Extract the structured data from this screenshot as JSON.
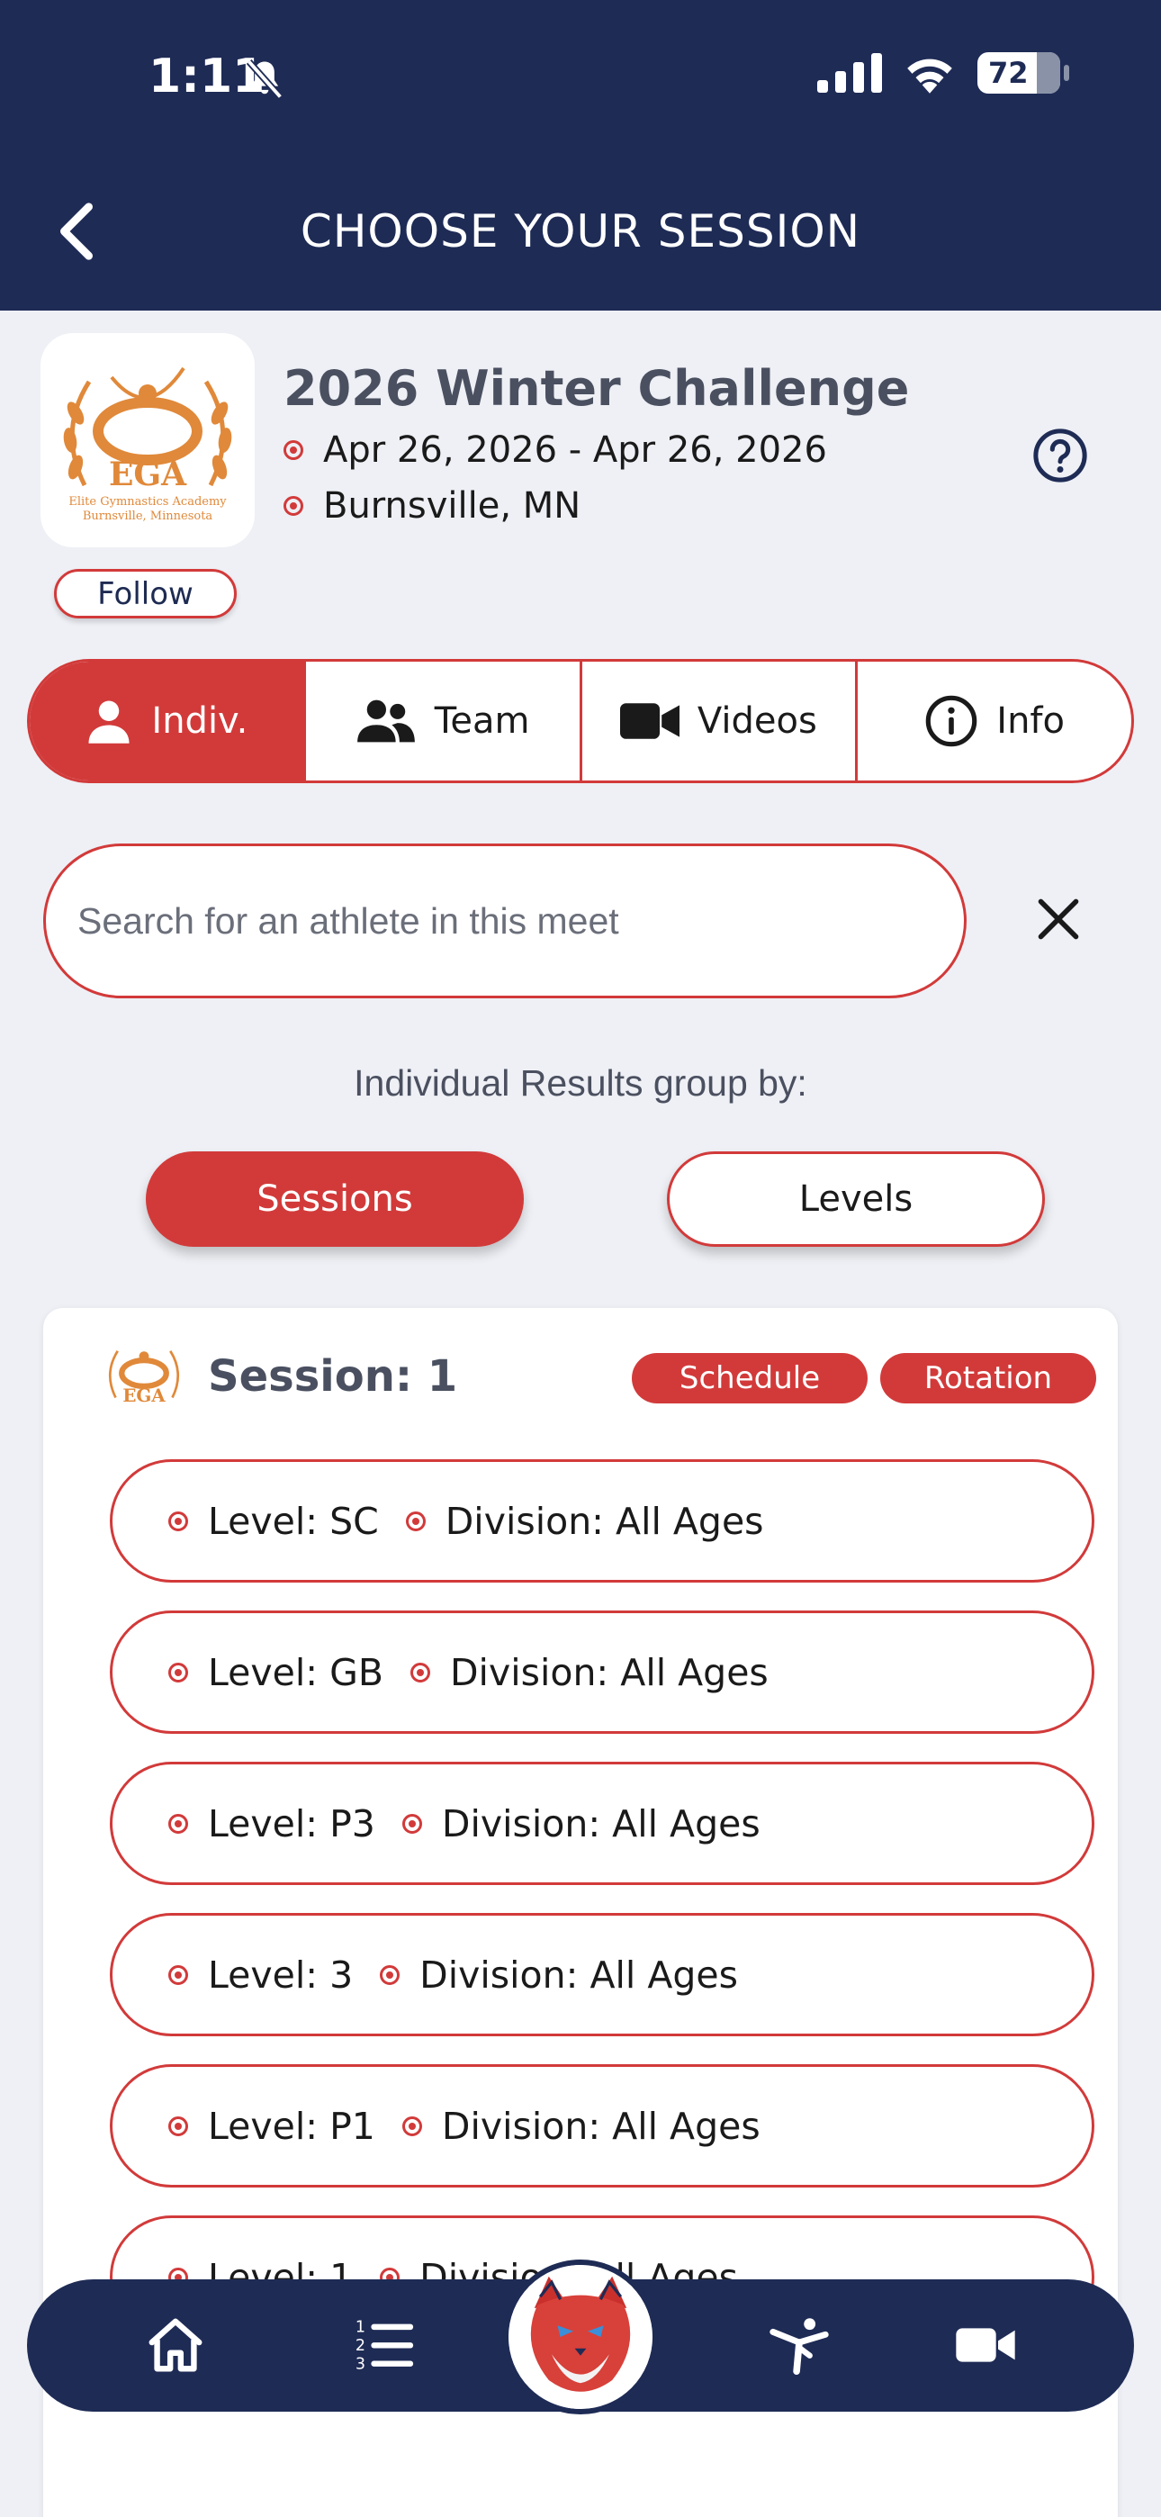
{
  "status_bar": {
    "time": "1:11",
    "battery": "72"
  },
  "header": {
    "title": "CHOOSE YOUR SESSION"
  },
  "meet": {
    "logo_text": "EGA",
    "logo_subtitle_1": "Elite Gymnastics Academy",
    "logo_subtitle_2": "Burnsville, Minnesota",
    "title": "2026 Winter Challenge",
    "dates": "Apr 26, 2026 - Apr 26, 2026",
    "location": "Burnsville, MN",
    "follow_label": "Follow"
  },
  "tabs": [
    {
      "label": "Indiv.",
      "icon": "person-icon",
      "active": true
    },
    {
      "label": "Team",
      "icon": "people-icon",
      "active": false
    },
    {
      "label": "Videos",
      "icon": "video-icon",
      "active": false
    },
    {
      "label": "Info",
      "icon": "info-icon",
      "active": false
    }
  ],
  "search": {
    "placeholder": "Search for an athlete in this meet",
    "value": ""
  },
  "grouping": {
    "label": "Individual Results group by:",
    "sessions_label": "Sessions",
    "levels_label": "Levels",
    "selected": "Sessions"
  },
  "session": {
    "title": "Session: 1",
    "schedule_label": "Schedule",
    "rotation_label": "Rotation",
    "levels": [
      {
        "level": "Level: SC",
        "division": "Division: All Ages"
      },
      {
        "level": "Level: GB",
        "division": "Division: All Ages"
      },
      {
        "level": "Level: P3",
        "division": "Division: All Ages"
      },
      {
        "level": "Level: 3",
        "division": "Division: All Ages"
      },
      {
        "level": "Level: P1",
        "division": "Division: All Ages"
      },
      {
        "level": "Level: 1",
        "division": "Division: All Ages"
      }
    ]
  },
  "bottom_nav": [
    {
      "icon": "home-icon"
    },
    {
      "icon": "ordered-list-icon"
    },
    {
      "icon": "mascot-cat-logo"
    },
    {
      "icon": "gymnast-icon"
    },
    {
      "icon": "video-camera-icon"
    }
  ],
  "colors": {
    "navy": "#1e2b55",
    "accent_red": "#d23a3a",
    "background": "#eef0f5"
  }
}
